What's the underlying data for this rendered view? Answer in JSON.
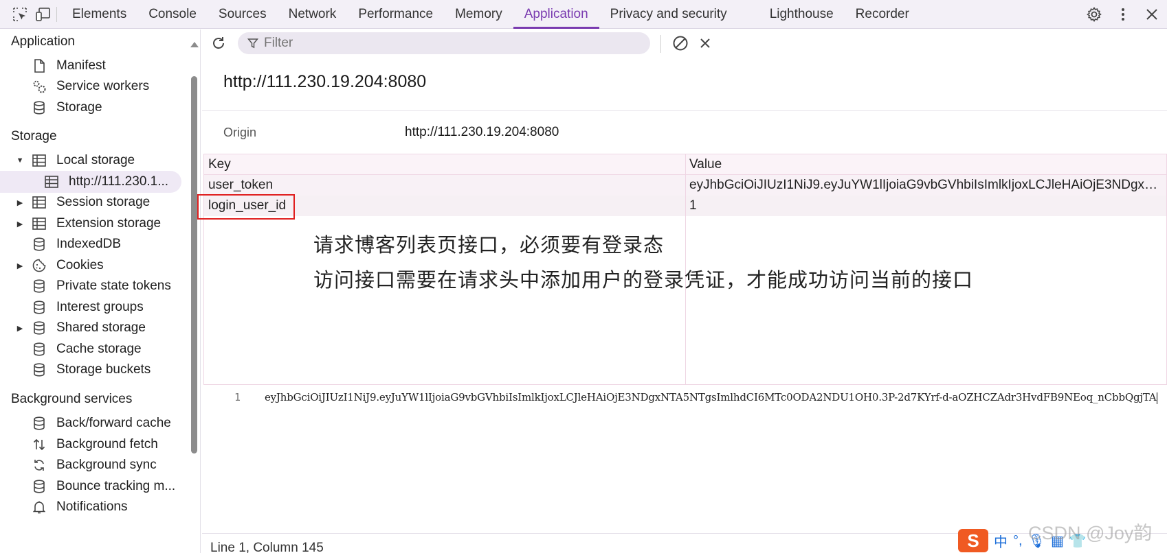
{
  "tabs": [
    "Elements",
    "Console",
    "Sources",
    "Network",
    "Performance",
    "Memory",
    "Application",
    "Privacy and security",
    "Lighthouse",
    "Recorder"
  ],
  "active_tab": "Application",
  "sidebar": {
    "application_title": "Application",
    "application_items": [
      "Manifest",
      "Service workers",
      "Storage"
    ],
    "storage_title": "Storage",
    "local_storage": "Local storage",
    "local_storage_child": "http://111.230.1...",
    "storage_items": [
      "Session storage",
      "Extension storage",
      "IndexedDB",
      "Cookies",
      "Private state tokens",
      "Interest groups",
      "Shared storage",
      "Cache storage",
      "Storage buckets"
    ],
    "background_title": "Background services",
    "background_items": [
      "Back/forward cache",
      "Background fetch",
      "Background sync",
      "Bounce tracking m...",
      "Notifications"
    ]
  },
  "toolbar": {
    "filter_placeholder": "Filter"
  },
  "origin_title": "http://111.230.19.204:8080",
  "origin_label": "Origin",
  "origin_value": "http://111.230.19.204:8080",
  "table": {
    "headers": [
      "Key",
      "Value"
    ],
    "rows": [
      {
        "key": "user_token",
        "value": "eyJhbGciOiJIUzI1NiJ9.eyJuYW1lIjoiaG9vbGVhbiIsImlkIjoxLCJleHAiOjE3NDgxNTA5NTgsImlhdCI6MTc0ODA2NDU1OH0.3P-2d7KYrf-d-aOZHCZAdr3HvdFB9NEoq_nCbbQgjTA"
      },
      {
        "key": "login_user_id",
        "value": "1"
      }
    ]
  },
  "annotation": {
    "line1": "请求博客列表页接口，必须要有登录态",
    "line2": "访问接口需要在请求头中添加用户的登录凭证，才能成功访问当前的接口"
  },
  "code": {
    "line_number": "1",
    "text": "eyJhbGciOiJIUzI1NiJ9.eyJuYW1lIjoiaG9vbGVhbiIsImlkIjoxLCJleHAiOjE3NDgxNTA5NTgsImlhdCI6MTc0ODA2NDU1OH0.3P-2d7KYrf-d-aOZHCZAdr3HvdFB9NEoq_nCbbQgjTA"
  },
  "status": "Line 1, Column 145",
  "watermark": "CSDN @Joy韵",
  "tray": {
    "ime": "中",
    "sogou": "S"
  },
  "colors": {
    "accent": "#7a3bb0",
    "highlight_box": "#e02020"
  }
}
